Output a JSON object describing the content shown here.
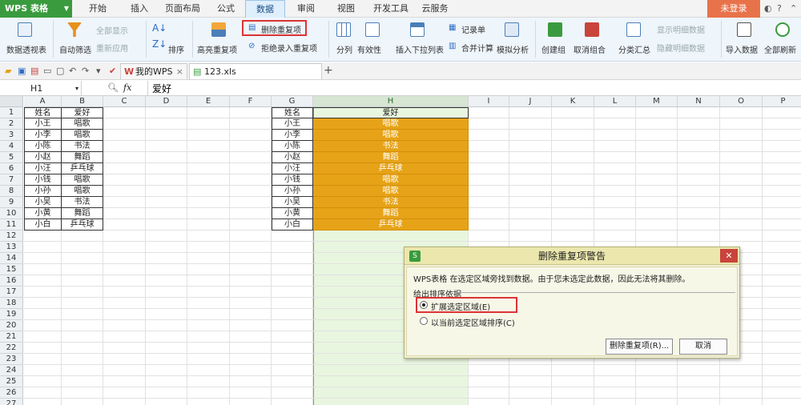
{
  "app": {
    "name": "WPS 表格"
  },
  "menu_tabs": [
    {
      "label": "开始"
    },
    {
      "label": "插入"
    },
    {
      "label": "页面布局"
    },
    {
      "label": "公式"
    },
    {
      "label": "数据"
    },
    {
      "label": "审阅"
    },
    {
      "label": "视图"
    },
    {
      "label": "开发工具"
    },
    {
      "label": "云服务"
    }
  ],
  "login_label": "未登录",
  "ribbon": {
    "pivot": "数据透视表",
    "autofilter": "自动筛选",
    "show_all": "全部显示",
    "reapply": "重新应用",
    "sort": "排序",
    "highlight_dup": "高亮重复项",
    "delete_dup": "删除重复项",
    "reject_dup": "拒绝录入重复项",
    "split": "分列",
    "validity": "有效性",
    "insert_dropdown": "插入下拉列表",
    "record_list": "记录单",
    "merge_calc": "合并计算",
    "sim_analysis": "模拟分析",
    "create_group": "创建组",
    "ungroup": "取消组合",
    "subtotal": "分类汇总",
    "show_detail": "显示明细数据",
    "hide_detail": "隐藏明细数据",
    "import_data": "导入数据",
    "refresh_all": "全部刷新"
  },
  "doc_tabs": [
    {
      "label": "我的WPS"
    },
    {
      "label": "123.xls"
    }
  ],
  "formula_bar": {
    "cell_ref": "H1",
    "fx": "fx",
    "value": "爱好"
  },
  "columns": [
    "A",
    "B",
    "C",
    "D",
    "E",
    "F",
    "G",
    "H",
    "I",
    "J",
    "K",
    "L",
    "M",
    "N",
    "O",
    "P"
  ],
  "rows": [
    "1",
    "2",
    "3",
    "4",
    "5",
    "6",
    "7",
    "8",
    "9",
    "10",
    "11",
    "12",
    "13",
    "14",
    "15",
    "16",
    "17",
    "18",
    "19",
    "20",
    "21",
    "22",
    "23",
    "24",
    "25",
    "26",
    "27"
  ],
  "table_left": {
    "header": [
      "姓名",
      "爱好"
    ],
    "rows": [
      [
        "小王",
        "唱歌"
      ],
      [
        "小李",
        "唱歌"
      ],
      [
        "小陈",
        "书法"
      ],
      [
        "小赵",
        "舞蹈"
      ],
      [
        "小汪",
        "乒乓球"
      ],
      [
        "小钱",
        "唱歌"
      ],
      [
        "小孙",
        "唱歌"
      ],
      [
        "小吴",
        "书法"
      ],
      [
        "小黄",
        "舞蹈"
      ],
      [
        "小白",
        "乒乓球"
      ]
    ]
  },
  "table_right": {
    "header": [
      "姓名",
      "爱好"
    ],
    "rows": [
      [
        "小王",
        "唱歌"
      ],
      [
        "小李",
        "唱歌"
      ],
      [
        "小陈",
        "书法"
      ],
      [
        "小赵",
        "舞蹈"
      ],
      [
        "小汪",
        "乒乓球"
      ],
      [
        "小钱",
        "唱歌"
      ],
      [
        "小孙",
        "唱歌"
      ],
      [
        "小吴",
        "书法"
      ],
      [
        "小黄",
        "舞蹈"
      ],
      [
        "小白",
        "乒乓球"
      ]
    ]
  },
  "dialog": {
    "title": "删除重复项警告",
    "message": "WPS表格 在选定区域旁找到数据。由于您未选定此数据，因此无法将其删除。",
    "group_label": "给出排序依据",
    "option_expand": "扩展选定区域(E)",
    "option_current": "以当前选定区域排序(C)",
    "btn_delete": "删除重复项(R)...",
    "btn_cancel": "取消"
  },
  "colors": {
    "accent_green": "#3a9b3e",
    "highlight_orange": "#e6a317",
    "login_orange": "#e8734a"
  }
}
